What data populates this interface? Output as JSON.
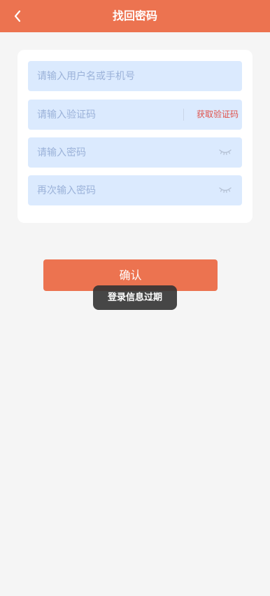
{
  "header": {
    "title": "找回密码",
    "back_icon": "chevron-left-icon",
    "background_color": "#ec7350"
  },
  "form": {
    "username": {
      "placeholder": "请输入用户名或手机号",
      "value": ""
    },
    "code": {
      "placeholder": "请输入验证码",
      "value": "",
      "button_label": "获取验证码",
      "button_color": "#e0514a"
    },
    "password": {
      "placeholder": "请输入密码",
      "value": "",
      "toggle_icon": "eye-closed-icon"
    },
    "confirm_password": {
      "placeholder": "再次输入密码",
      "value": "",
      "toggle_icon": "eye-closed-icon"
    }
  },
  "confirm_button": {
    "label": "确认",
    "color": "#ec7350"
  },
  "toast": {
    "text": "登录信息过期"
  }
}
